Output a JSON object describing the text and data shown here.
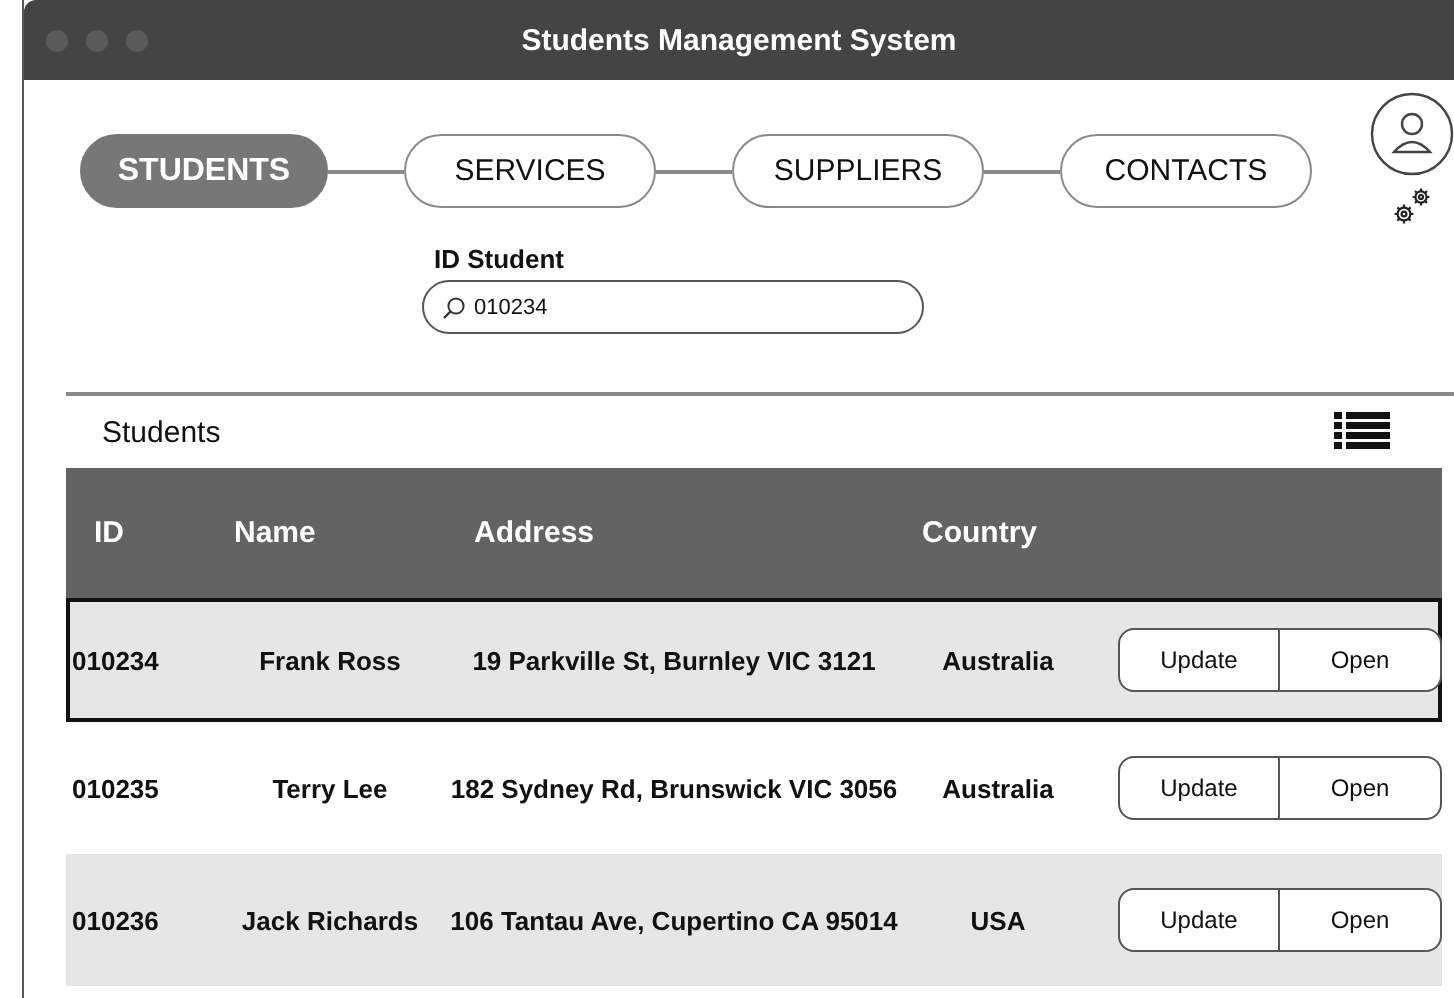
{
  "window": {
    "title": "Students Management System"
  },
  "tabs": [
    {
      "label": "STUDENTS",
      "selected": true
    },
    {
      "label": "SERVICES",
      "selected": false
    },
    {
      "label": "SUPPLIERS",
      "selected": false
    },
    {
      "label": "CONTACTS",
      "selected": false
    }
  ],
  "search": {
    "label": "ID Student",
    "value": "010234"
  },
  "table": {
    "title": "Students",
    "columns": [
      "ID",
      "Name",
      "Address",
      "Country"
    ],
    "rows": [
      {
        "cells": [
          "010234",
          "Frank Ross",
          "19 Parkville St, Burnley VIC 3121",
          "Australia"
        ],
        "selected": true,
        "buttons": [
          "Update",
          "Open"
        ]
      },
      {
        "cells": [
          "010235",
          "Terry Lee",
          "182 Sydney Rd, Brunswick VIC 3056",
          "Australia"
        ],
        "selected": false,
        "buttons": [
          "Update",
          "Open"
        ]
      },
      {
        "cells": [
          "010236",
          "Jack Richards",
          "106 Tantau Ave, Cupertino CA 95014",
          "USA"
        ],
        "selected": false,
        "buttons": [
          "Update",
          "Open"
        ]
      }
    ]
  }
}
